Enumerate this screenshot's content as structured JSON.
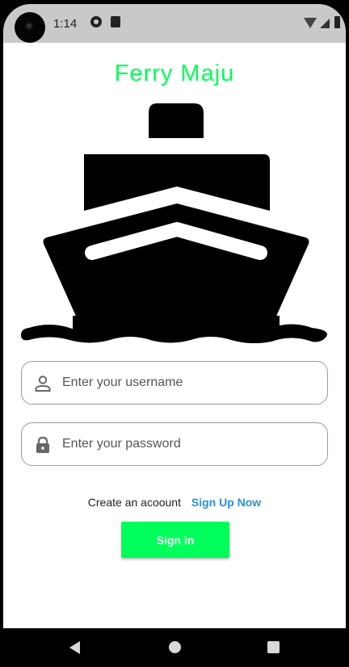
{
  "status_bar": {
    "time": "1:14",
    "icons": [
      "camera-icon",
      "vpn-icon",
      "sd-card-icon",
      "wifi-icon",
      "signal-icon",
      "battery-icon"
    ]
  },
  "app": {
    "title": "Ferry Maju",
    "title_color": "#00ff55",
    "logo_icon": "ship-icon"
  },
  "form": {
    "username": {
      "placeholder": "Enter your username",
      "value": "",
      "icon": "person-icon"
    },
    "password": {
      "placeholder": "Enter your password",
      "value": "",
      "icon": "lock-icon"
    },
    "signup_prompt": "Create an acoount",
    "signup_link": "Sign Up Now",
    "signup_link_color": "#2a8fe0",
    "signin_label": "Sign in",
    "signin_color": "#00ff5a"
  },
  "nav_bar": {
    "icons": [
      "back-icon",
      "home-icon",
      "recents-icon"
    ]
  }
}
